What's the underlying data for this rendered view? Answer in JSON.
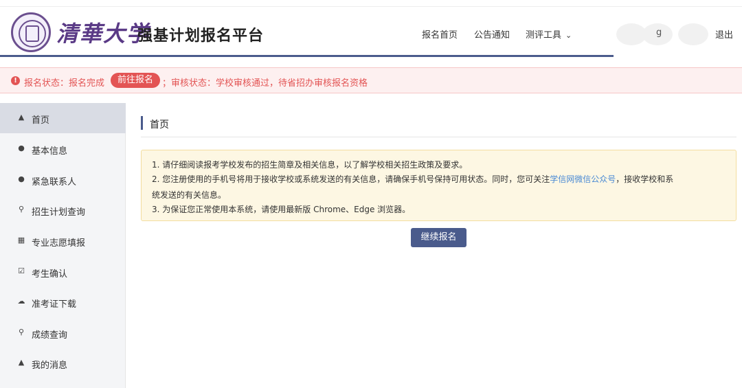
{
  "header": {
    "university_name": "清華大学",
    "platform_title": "强基计划报名平台",
    "nav": [
      {
        "label": "报名首页"
      },
      {
        "label": "公告通知"
      },
      {
        "label": "测评工具"
      }
    ],
    "user_name": "g",
    "logout_label": "退出"
  },
  "status": {
    "registration_status": "报名状态：报名完成",
    "go_button": "前往报名",
    "review_status": "；审核状态：学校审核通过，待省招办审核报名资格"
  },
  "sidebar": {
    "items": [
      {
        "label": "首页",
        "icon": "home-icon",
        "active": true
      },
      {
        "label": "基本信息",
        "icon": "user-icon"
      },
      {
        "label": "紧急联系人",
        "icon": "user-icon"
      },
      {
        "label": "招生计划查询",
        "icon": "search-icon"
      },
      {
        "label": "专业志愿填报",
        "icon": "form-icon"
      },
      {
        "label": "考生确认",
        "icon": "check-icon"
      },
      {
        "label": "准考证下载",
        "icon": "cloud-download-icon"
      },
      {
        "label": "成绩查询",
        "icon": "search-icon"
      },
      {
        "label": "我的消息",
        "icon": "bell-icon"
      }
    ]
  },
  "main": {
    "section_title": "首页",
    "notice": {
      "line1": "1. 请仔细阅读报考学校发布的招生简章及相关信息，以了解学校相关招生政策及要求。",
      "line2_before": "2. 您注册使用的手机号将用于接收学校或系统发送的有关信息，请确保手机号保持可用状态。同时，您可关注",
      "line2_link": "学信网微信公众号",
      "line2_after": "，接收学校和系",
      "line3": "统发送的有关信息。",
      "line4": "3. 为保证您正常使用本系统，请使用最新版 Chrome、Edge 浏览器。"
    },
    "continue_button": "继续报名"
  },
  "colors": {
    "brand": "#4a5b8c",
    "alert": "#e35454",
    "notice_bg": "#fdf7e3",
    "link": "#4a8ad4"
  }
}
